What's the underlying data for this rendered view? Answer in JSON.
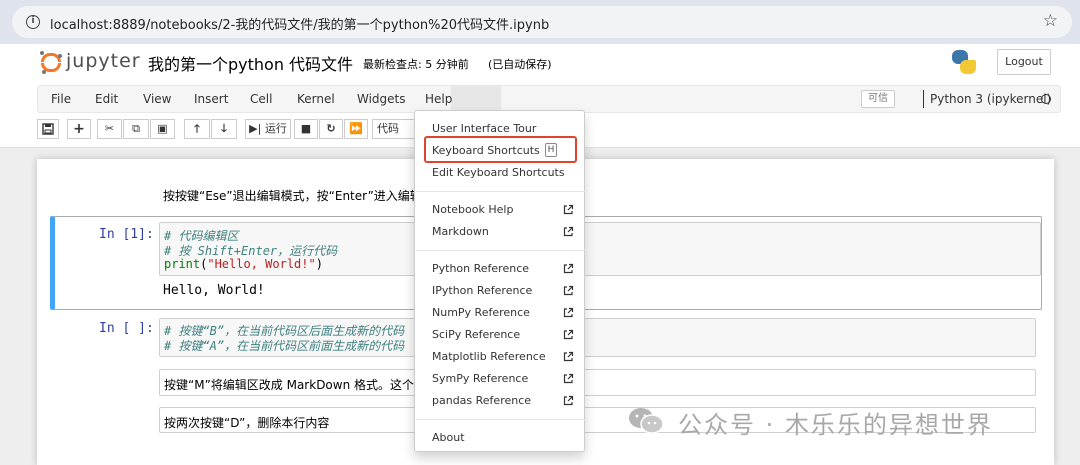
{
  "browser": {
    "url": "localhost:8889/notebooks/2-我的代码文件/我的第一个python%20代码文件.ipynb"
  },
  "header": {
    "logo_text": "jupyter",
    "notebook_title": "我的第一个python 代码文件",
    "checkpoint": "最新检查点: 5 分钟前",
    "autosave": "(已自动保存)",
    "logout_label": "Logout"
  },
  "menubar": {
    "items": [
      "File",
      "Edit",
      "View",
      "Insert",
      "Cell",
      "Kernel",
      "Widgets",
      "Help"
    ],
    "trusted": "可信",
    "kernel": "Python 3 (ipykernel)"
  },
  "toolbar": {
    "run_label": "运行",
    "cell_type": "代码"
  },
  "cells": {
    "md_instruction": "按按键“Ese”退出编辑模式，按“Enter”进入编辑",
    "cell1": {
      "prompt": "In [1]:",
      "lines": [
        "# 代码编辑区",
        "# 按 Shift+Enter，运行代码"
      ],
      "print_kw": "print",
      "print_open": "(",
      "print_str": "\"Hello, World!\"",
      "print_close": ")",
      "output": "Hello, World!"
    },
    "cell2": {
      "prompt": "In [ ]:",
      "lines": [
        "# 按键“B”，在当前代码区后面生成新的代码",
        "# 按键“A”，在当前代码区前面生成新的代码"
      ]
    },
    "md_m": "按键“M”将编辑区改成 MarkDown 格式。这个",
    "md_d": "按两次按键“D”，删除本行内容"
  },
  "help_menu": {
    "group1": [
      "User Interface Tour",
      "Keyboard Shortcuts",
      "Edit Keyboard Shortcuts"
    ],
    "shortcut_key": "H",
    "group2": [
      "Notebook Help",
      "Markdown"
    ],
    "group3": [
      "Python Reference",
      "IPython Reference",
      "NumPy Reference",
      "SciPy Reference",
      "Matplotlib Reference",
      "SymPy Reference",
      "pandas Reference"
    ],
    "about": "About",
    "highlight_color": "#e0442c"
  },
  "watermark": {
    "text": "公众号 · 木乐乐的异想世界"
  },
  "colors": {
    "jupyter_orange": "#f37726",
    "selected_cell_border": "#42a5f5",
    "prompt_blue": "#303f9f"
  }
}
